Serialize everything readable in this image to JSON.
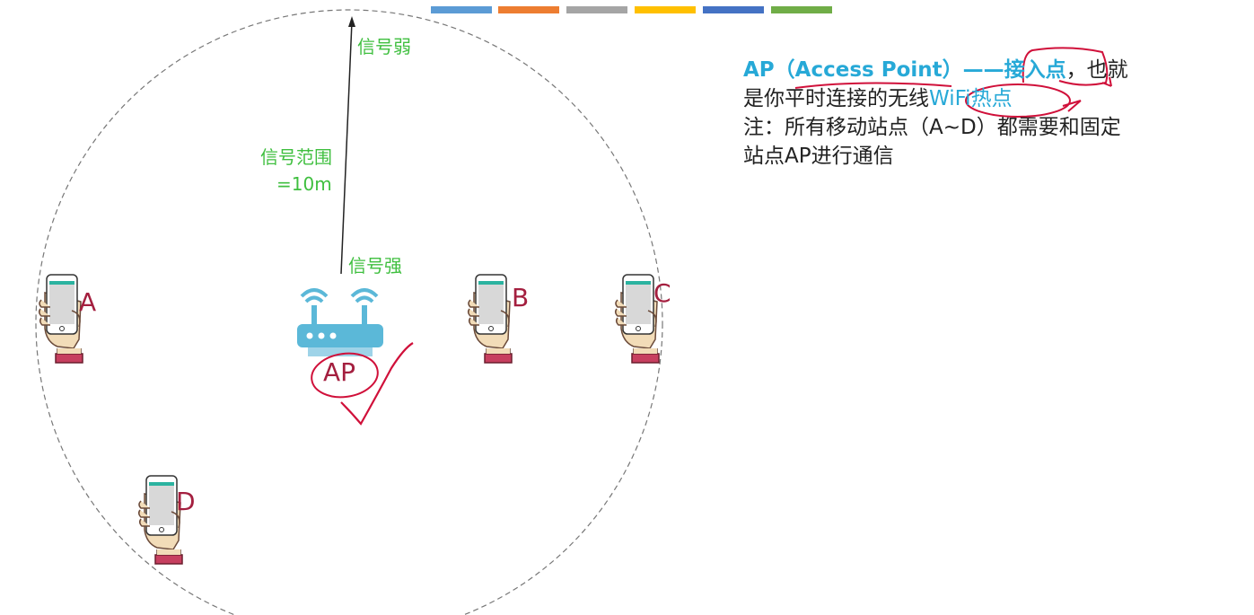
{
  "top_bar_colors": [
    "#5b9bd5",
    "#ed7d31",
    "#a5a5a5",
    "#ffc000",
    "#4472c4",
    "#70ad47"
  ],
  "labels": {
    "signal_weak": "信号弱",
    "signal_range_line1": "信号范围",
    "signal_range_line2": "=10m",
    "signal_strong": "信号强",
    "ap": "AP"
  },
  "devices": [
    {
      "id": "A",
      "label": "A"
    },
    {
      "id": "B",
      "label": "B"
    },
    {
      "id": "C",
      "label": "C"
    },
    {
      "id": "D",
      "label": "D"
    }
  ],
  "text": {
    "line1_ap": "AP（",
    "line1_access_point": "Access Point",
    "line1_paren": "）——",
    "line1_jierudian": "接入点",
    "line1_rest": "，也就",
    "line2_prefix": "是你平时连接的无线",
    "line2_wifi": "WiFi热点",
    "line3": "注：所有移动站点（A~D）都需要和固定",
    "line4": "站点AP进行通信"
  },
  "colors": {
    "label_green": "#3fbf3f",
    "device_letter": "#a41f3f",
    "accent_cyan": "#27a9d7",
    "annotation_red": "#d0103a",
    "router_blue": "#5bb8d8"
  }
}
